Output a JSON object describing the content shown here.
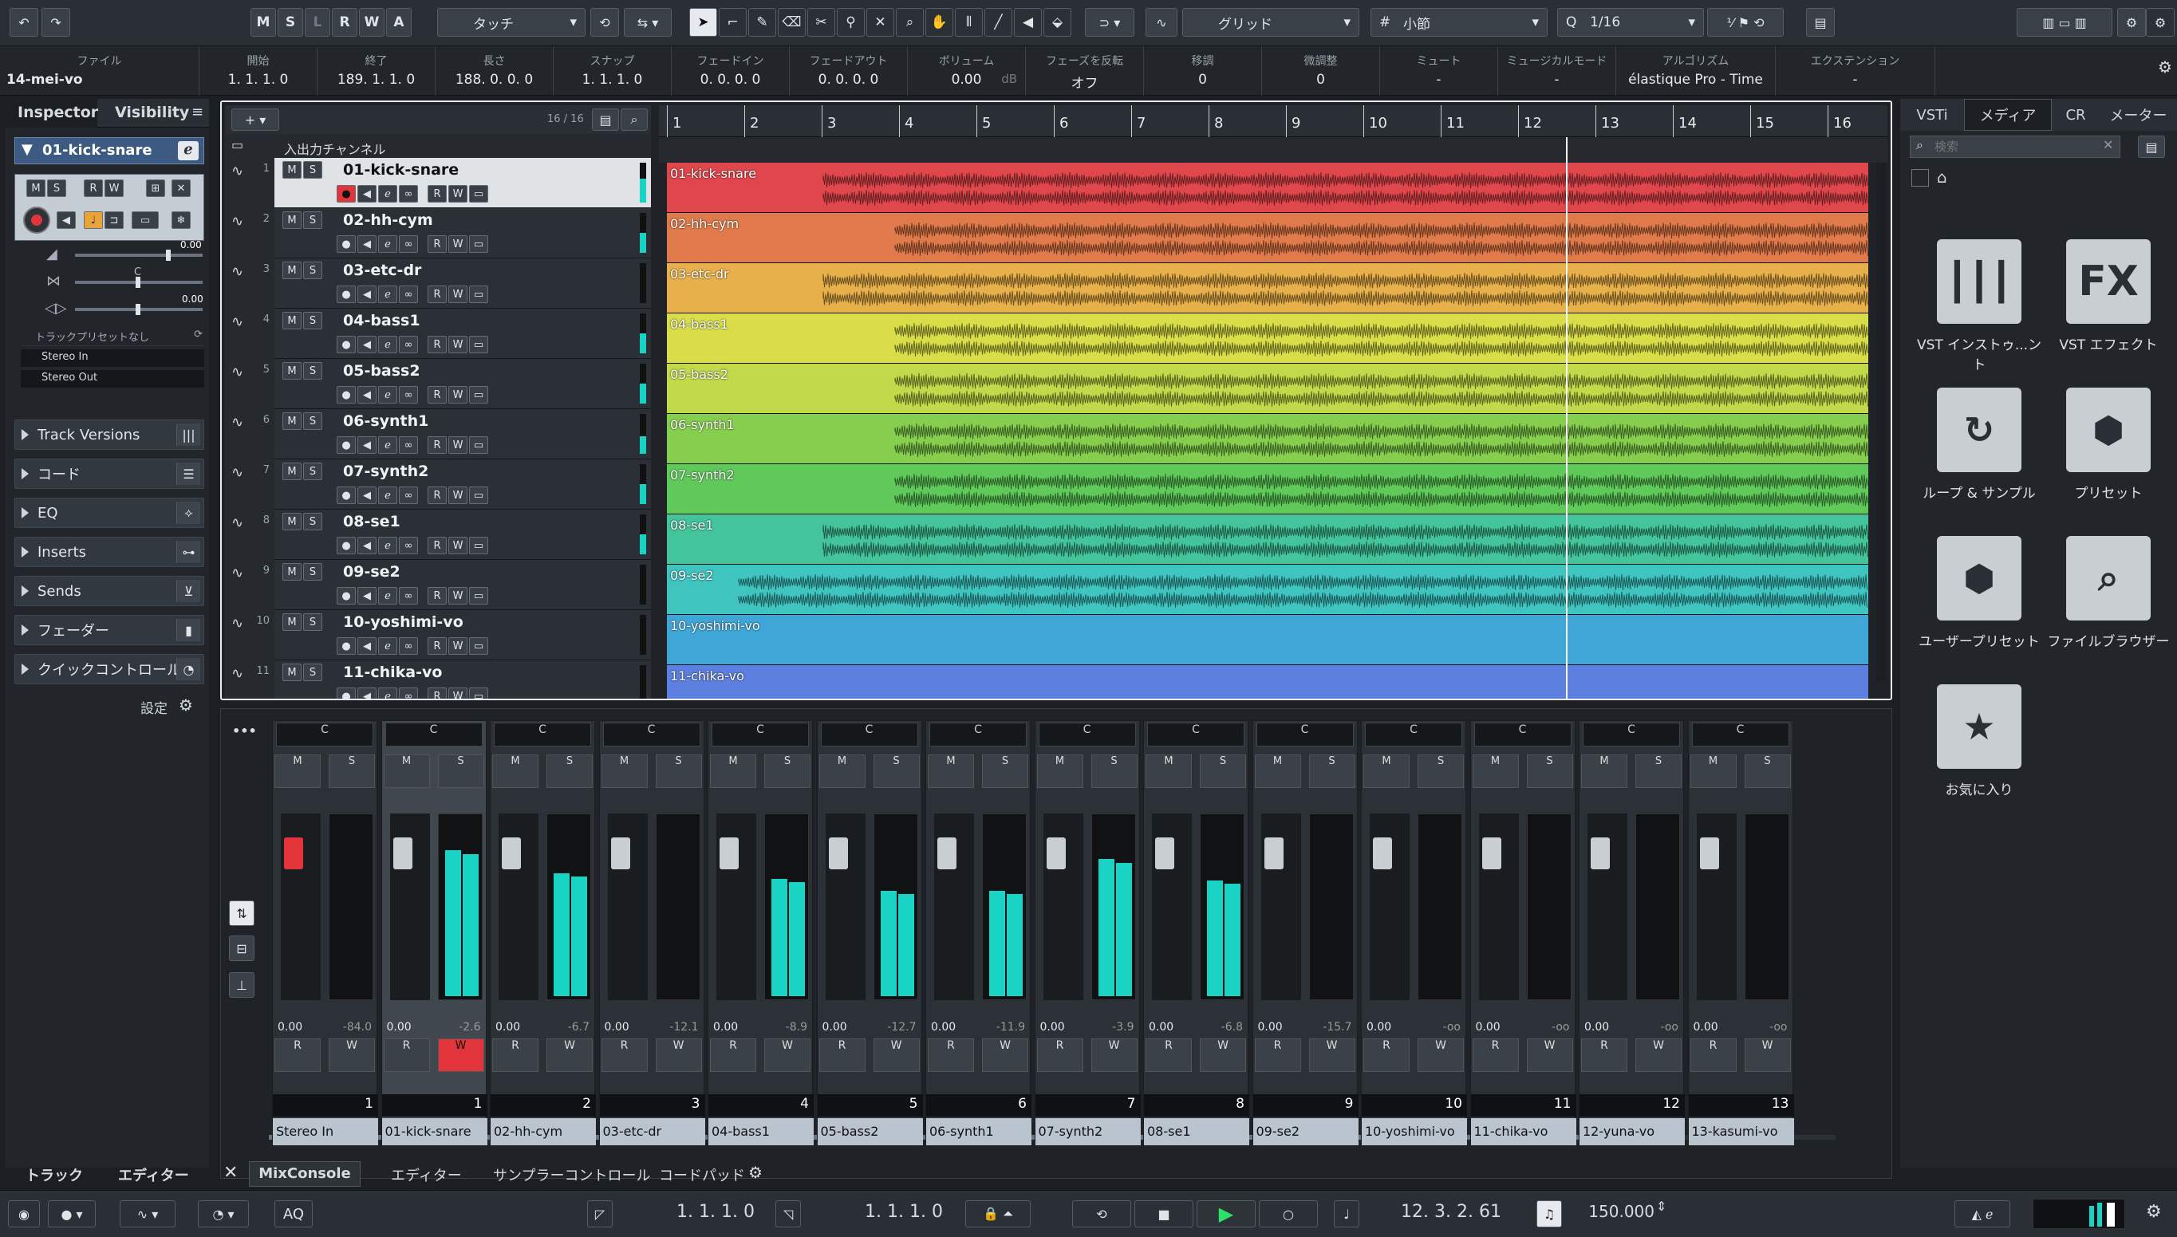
{
  "toolbar": {
    "msrw": [
      "M",
      "S",
      "L",
      "R",
      "W",
      "A"
    ],
    "automation_mode": "タッチ",
    "snap_type": "グリッド",
    "grid_label": "小節",
    "quantize": "1/16"
  },
  "infoline": [
    {
      "label": "ファイル",
      "value": "14-mei-vo"
    },
    {
      "label": "開始",
      "value": "1. 1. 1. 0"
    },
    {
      "label": "終了",
      "value": "189. 1. 1. 0"
    },
    {
      "label": "長さ",
      "value": "188. 0. 0. 0"
    },
    {
      "label": "スナップ",
      "value": "1. 1. 1. 0"
    },
    {
      "label": "フェードイン",
      "value": "0. 0. 0. 0"
    },
    {
      "label": "フェードアウト",
      "value": "0. 0. 0. 0"
    },
    {
      "label": "ボリューム",
      "value": "0.00"
    },
    {
      "label": "フェーズを反転",
      "value": "オフ"
    },
    {
      "label": "移調",
      "value": "0"
    },
    {
      "label": "微調整",
      "value": "0"
    },
    {
      "label": "ミュート",
      "value": "-"
    },
    {
      "label": "ミュージカルモード",
      "value": "-"
    },
    {
      "label": "アルゴリズム",
      "value": "élastique Pro - Time"
    },
    {
      "label": "エクステンション",
      "value": "-"
    }
  ],
  "volume_unit": "dB",
  "inspector": {
    "tabs": [
      "Inspector",
      "Visibility"
    ],
    "track_name": "01-kick-snare",
    "vol_value": "0.00",
    "pan_value": "C",
    "delay_value": "0.00",
    "preset": "トラックプリセットなし",
    "input": "Stereo In",
    "output": "Stereo Out",
    "sections": [
      "Track Versions",
      "コード",
      "EQ",
      "Inserts",
      "Sends",
      "フェーダー",
      "クイックコントロール"
    ],
    "settings": "設定"
  },
  "project": {
    "track_count": "16 / 16",
    "folder_name": "入出力チャンネル",
    "bars": [
      "1",
      "2",
      "3",
      "4",
      "5",
      "6",
      "7",
      "8",
      "9",
      "10",
      "11",
      "12",
      "13",
      "14",
      "15",
      "16"
    ],
    "tracks": [
      {
        "num": "1",
        "name": "01-kick-snare",
        "color": "#e0474c",
        "level": 0.6,
        "start": 0.13
      },
      {
        "num": "2",
        "name": "02-hh-cym",
        "color": "#e07a4a",
        "level": 0.5,
        "start": 0.19
      },
      {
        "num": "3",
        "name": "03-etc-dr",
        "color": "#e8b04a",
        "level": 0.0,
        "start": 0.13
      },
      {
        "num": "4",
        "name": "04-bass1",
        "color": "#d9de48",
        "level": 0.5,
        "start": 0.19
      },
      {
        "num": "5",
        "name": "05-bass2",
        "color": "#c2d94a",
        "level": 0.5,
        "start": 0.19
      },
      {
        "num": "6",
        "name": "06-synth1",
        "color": "#86cf4e",
        "level": 0.45,
        "start": 0.19
      },
      {
        "num": "7",
        "name": "07-synth2",
        "color": "#5fc95a",
        "level": 0.5,
        "start": 0.19
      },
      {
        "num": "8",
        "name": "08-se1",
        "color": "#43c49a",
        "level": 0.5,
        "start": 0.13
      },
      {
        "num": "9",
        "name": "09-se2",
        "color": "#3fc4c0",
        "level": 0.0,
        "start": 0.06
      },
      {
        "num": "10",
        "name": "10-yoshimi-vo",
        "color": "#3fa6d8",
        "level": 0.0,
        "start": 1.1
      },
      {
        "num": "11",
        "name": "11-chika-vo",
        "color": "#5c7fe0",
        "level": 0.0,
        "start": 1.1
      }
    ]
  },
  "media": {
    "tabs": [
      "VSTi",
      "メディア",
      "CR",
      "メーター"
    ],
    "search_placeholder": "検索",
    "tiles": [
      {
        "label": "VST インストゥ...ント",
        "icon": "piano-keys-icon",
        "glyph": "┃┃┃"
      },
      {
        "label": "VST エフェクト",
        "icon": "fx-icon",
        "glyph": "FX"
      },
      {
        "label": "ループ & サンプル",
        "icon": "loop-icon",
        "glyph": "↻"
      },
      {
        "label": "プリセット",
        "icon": "hexagons-icon",
        "glyph": "⬢"
      },
      {
        "label": "ユーザープリセット",
        "icon": "user-preset-icon",
        "glyph": "⬢"
      },
      {
        "label": "ファイルブラウザー",
        "icon": "file-browser-icon",
        "glyph": "⌕"
      },
      {
        "label": "お気に入り",
        "icon": "star-icon",
        "glyph": "★"
      }
    ]
  },
  "mixer": {
    "pan_label": "C",
    "mute": "M",
    "solo": "S",
    "read": "R",
    "write": "W",
    "channels": [
      {
        "name": "Stereo In",
        "num": "1",
        "vol": "0.00",
        "peak": "-84.0",
        "level": 0.0,
        "red": true
      },
      {
        "name": "01-kick-snare",
        "num": "1",
        "vol": "0.00",
        "peak": "-2.6",
        "level": 0.83,
        "sel": true
      },
      {
        "name": "02-hh-cym",
        "num": "2",
        "vol": "0.00",
        "peak": "-6.7",
        "level": 0.7
      },
      {
        "name": "03-etc-dr",
        "num": "3",
        "vol": "0.00",
        "peak": "-12.1",
        "level": 0.0
      },
      {
        "name": "04-bass1",
        "num": "4",
        "vol": "0.00",
        "peak": "-8.9",
        "level": 0.67
      },
      {
        "name": "05-bass2",
        "num": "5",
        "vol": "0.00",
        "peak": "-12.7",
        "level": 0.6
      },
      {
        "name": "06-synth1",
        "num": "6",
        "vol": "0.00",
        "peak": "-11.9",
        "level": 0.6
      },
      {
        "name": "07-synth2",
        "num": "7",
        "vol": "0.00",
        "peak": "-3.9",
        "level": 0.78
      },
      {
        "name": "08-se1",
        "num": "8",
        "vol": "0.00",
        "peak": "-6.8",
        "level": 0.66
      },
      {
        "name": "09-se2",
        "num": "9",
        "vol": "0.00",
        "peak": "-15.7",
        "level": 0.0
      },
      {
        "name": "10-yoshimi-vo",
        "num": "10",
        "vol": "0.00",
        "peak": "-oo",
        "level": 0.0
      },
      {
        "name": "11-chika-vo",
        "num": "11",
        "vol": "0.00",
        "peak": "-oo",
        "level": 0.0
      },
      {
        "name": "12-yuna-vo",
        "num": "12",
        "vol": "0.00",
        "peak": "-oo",
        "level": 0.0
      },
      {
        "name": "13-kasumi-vo",
        "num": "13",
        "vol": "0.00",
        "peak": "-oo",
        "level": 0.0
      }
    ]
  },
  "bottom_tabs": {
    "left": [
      "トラック",
      "エディター"
    ],
    "main": [
      "MixConsole",
      "エディター",
      "サンプラーコントロール",
      "コードパッド"
    ]
  },
  "transport": {
    "aq": "AQ",
    "left_locator": "1. 1. 1. 0",
    "right_locator": "1. 1. 1. 0",
    "position": "12. 3. 2. 61",
    "tempo": "150.000"
  }
}
